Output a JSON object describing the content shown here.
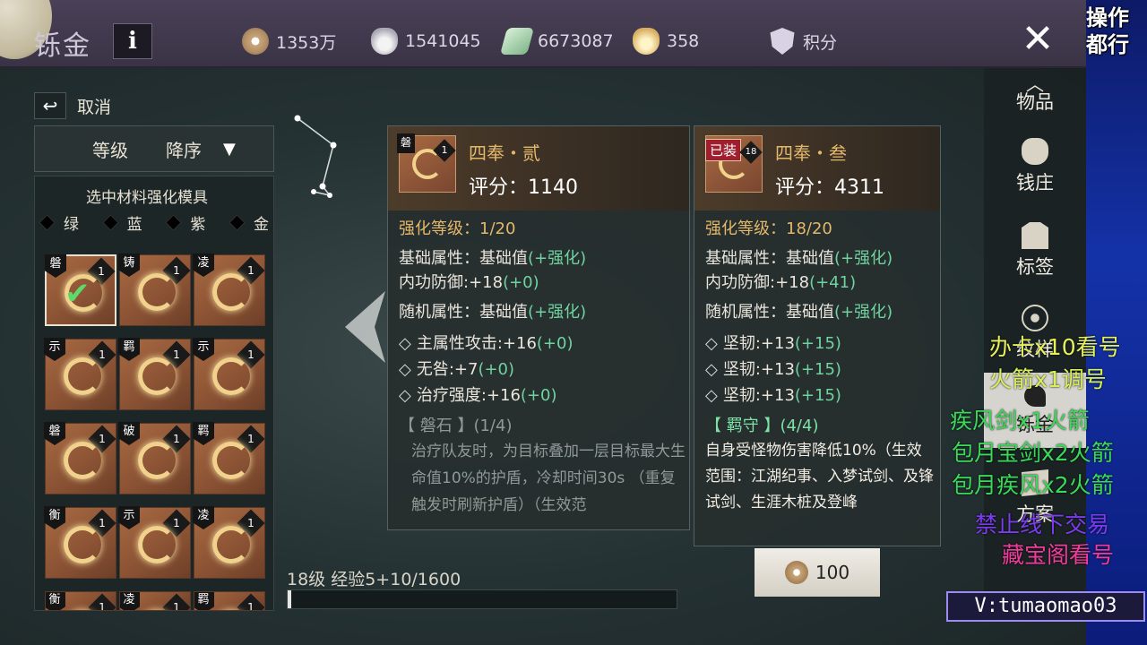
{
  "header": {
    "title": "铄金",
    "info_label": "i",
    "close_label": "✕",
    "currencies": [
      {
        "icon": "coin-icon",
        "value": "1353万"
      },
      {
        "icon": "silver-ingot-icon",
        "value": "1541045"
      },
      {
        "icon": "jade-icon",
        "value": "6673087"
      },
      {
        "icon": "gold-ingot-icon",
        "value": "358"
      },
      {
        "icon": "points-shield-icon",
        "value": "积分"
      }
    ]
  },
  "overlay": {
    "top_line_1": "操作",
    "top_line_2": "都行",
    "promos": [
      "办卡x10看号",
      "火箭x1调号",
      "疾风剑x1火箭",
      "包月宝剑x2火箭",
      "包月疾风x2火箭",
      "禁止线下交易",
      "藏宝阁看号"
    ],
    "vid": "V:tumaomao03"
  },
  "left_panel": {
    "cancel_label": "取消",
    "sort_field": "等级",
    "sort_order": "降序",
    "material_label": "选中材料强化模具",
    "filters": [
      "绿",
      "蓝",
      "紫",
      "金"
    ],
    "slots": [
      {
        "tag": "磐",
        "count": "1",
        "selected": true
      },
      {
        "tag": "铸",
        "count": "1"
      },
      {
        "tag": "凌",
        "count": "1"
      },
      {
        "tag": "示",
        "count": "1"
      },
      {
        "tag": "羁",
        "count": "1"
      },
      {
        "tag": "示",
        "count": "1"
      },
      {
        "tag": "磐",
        "count": "1"
      },
      {
        "tag": "破",
        "count": "1"
      },
      {
        "tag": "羁",
        "count": "1"
      },
      {
        "tag": "衡",
        "count": "1"
      },
      {
        "tag": "示",
        "count": "1"
      },
      {
        "tag": "凌",
        "count": "1"
      },
      {
        "tag": "衡",
        "count": "1"
      },
      {
        "tag": "凌",
        "count": "1"
      },
      {
        "tag": "羁",
        "count": "1"
      }
    ]
  },
  "card_a": {
    "tag": "磐",
    "count": "1",
    "name": "四奉・贰",
    "score": "评分：1140",
    "level_label": "强化等级：",
    "level_value": "1/20",
    "base_label": "基础属性：基础值",
    "base_hint": "(+强化)",
    "inner_def": "内功防御:+18",
    "inner_def_bonus": "(+0)",
    "random_label": "随机属性：基础值",
    "random_hint": "(+强化)",
    "stats": [
      {
        "text": "主属性攻击:+16",
        "bonus": "(+0)"
      },
      {
        "text": "无咎:+7",
        "bonus": "(+0)"
      },
      {
        "text": "治疗强度:+16",
        "bonus": "(+0)"
      }
    ],
    "set_name": "【 磐石 】",
    "set_count": "(1/4)",
    "set_desc": "治疗队友时，为目标叠加一层目标最大生命值10%的护盾，冷却时间30s （重复触发时刷新护盾）（生效范"
  },
  "card_b": {
    "equipped_label": "已装",
    "count": "18",
    "name": "四奉・叁",
    "score": "评分：4311",
    "level_label": "强化等级：",
    "level_value": "18/20",
    "base_label": "基础属性：基础值",
    "base_hint": "(+强化)",
    "inner_def": "内功防御:+18",
    "inner_def_bonus": "(+41)",
    "random_label": "随机属性：基础值",
    "random_hint": "(+强化)",
    "stats": [
      {
        "text": "坚韧:+13",
        "bonus": "(+15)"
      },
      {
        "text": "坚韧:+13",
        "bonus": "(+15)"
      },
      {
        "text": "坚韧:+13",
        "bonus": "(+15)"
      }
    ],
    "set_name": "【 羁守 】",
    "set_count": "(4/4)",
    "set_desc": "自身受怪物伤害降低10%（生效范围：江湖纪事、入梦试剑、及锋试剑、生涯木桩及登峰"
  },
  "cost": {
    "value": "100"
  },
  "exp": {
    "label": "18级 经验5+10/1600",
    "progress": 0.0094
  },
  "right_nav": {
    "up_label": "︿",
    "items": [
      {
        "label": "物品",
        "icon": "items-icon"
      },
      {
        "label": "钱庄",
        "icon": "bank-bag-icon"
      },
      {
        "label": "标签",
        "icon": "tag-icon"
      },
      {
        "label": "纹样",
        "icon": "nodes-icon"
      },
      {
        "label": "铄金",
        "icon": "swirl-icon",
        "active": true
      },
      {
        "label": "方案",
        "icon": "plan-icon"
      }
    ]
  }
}
